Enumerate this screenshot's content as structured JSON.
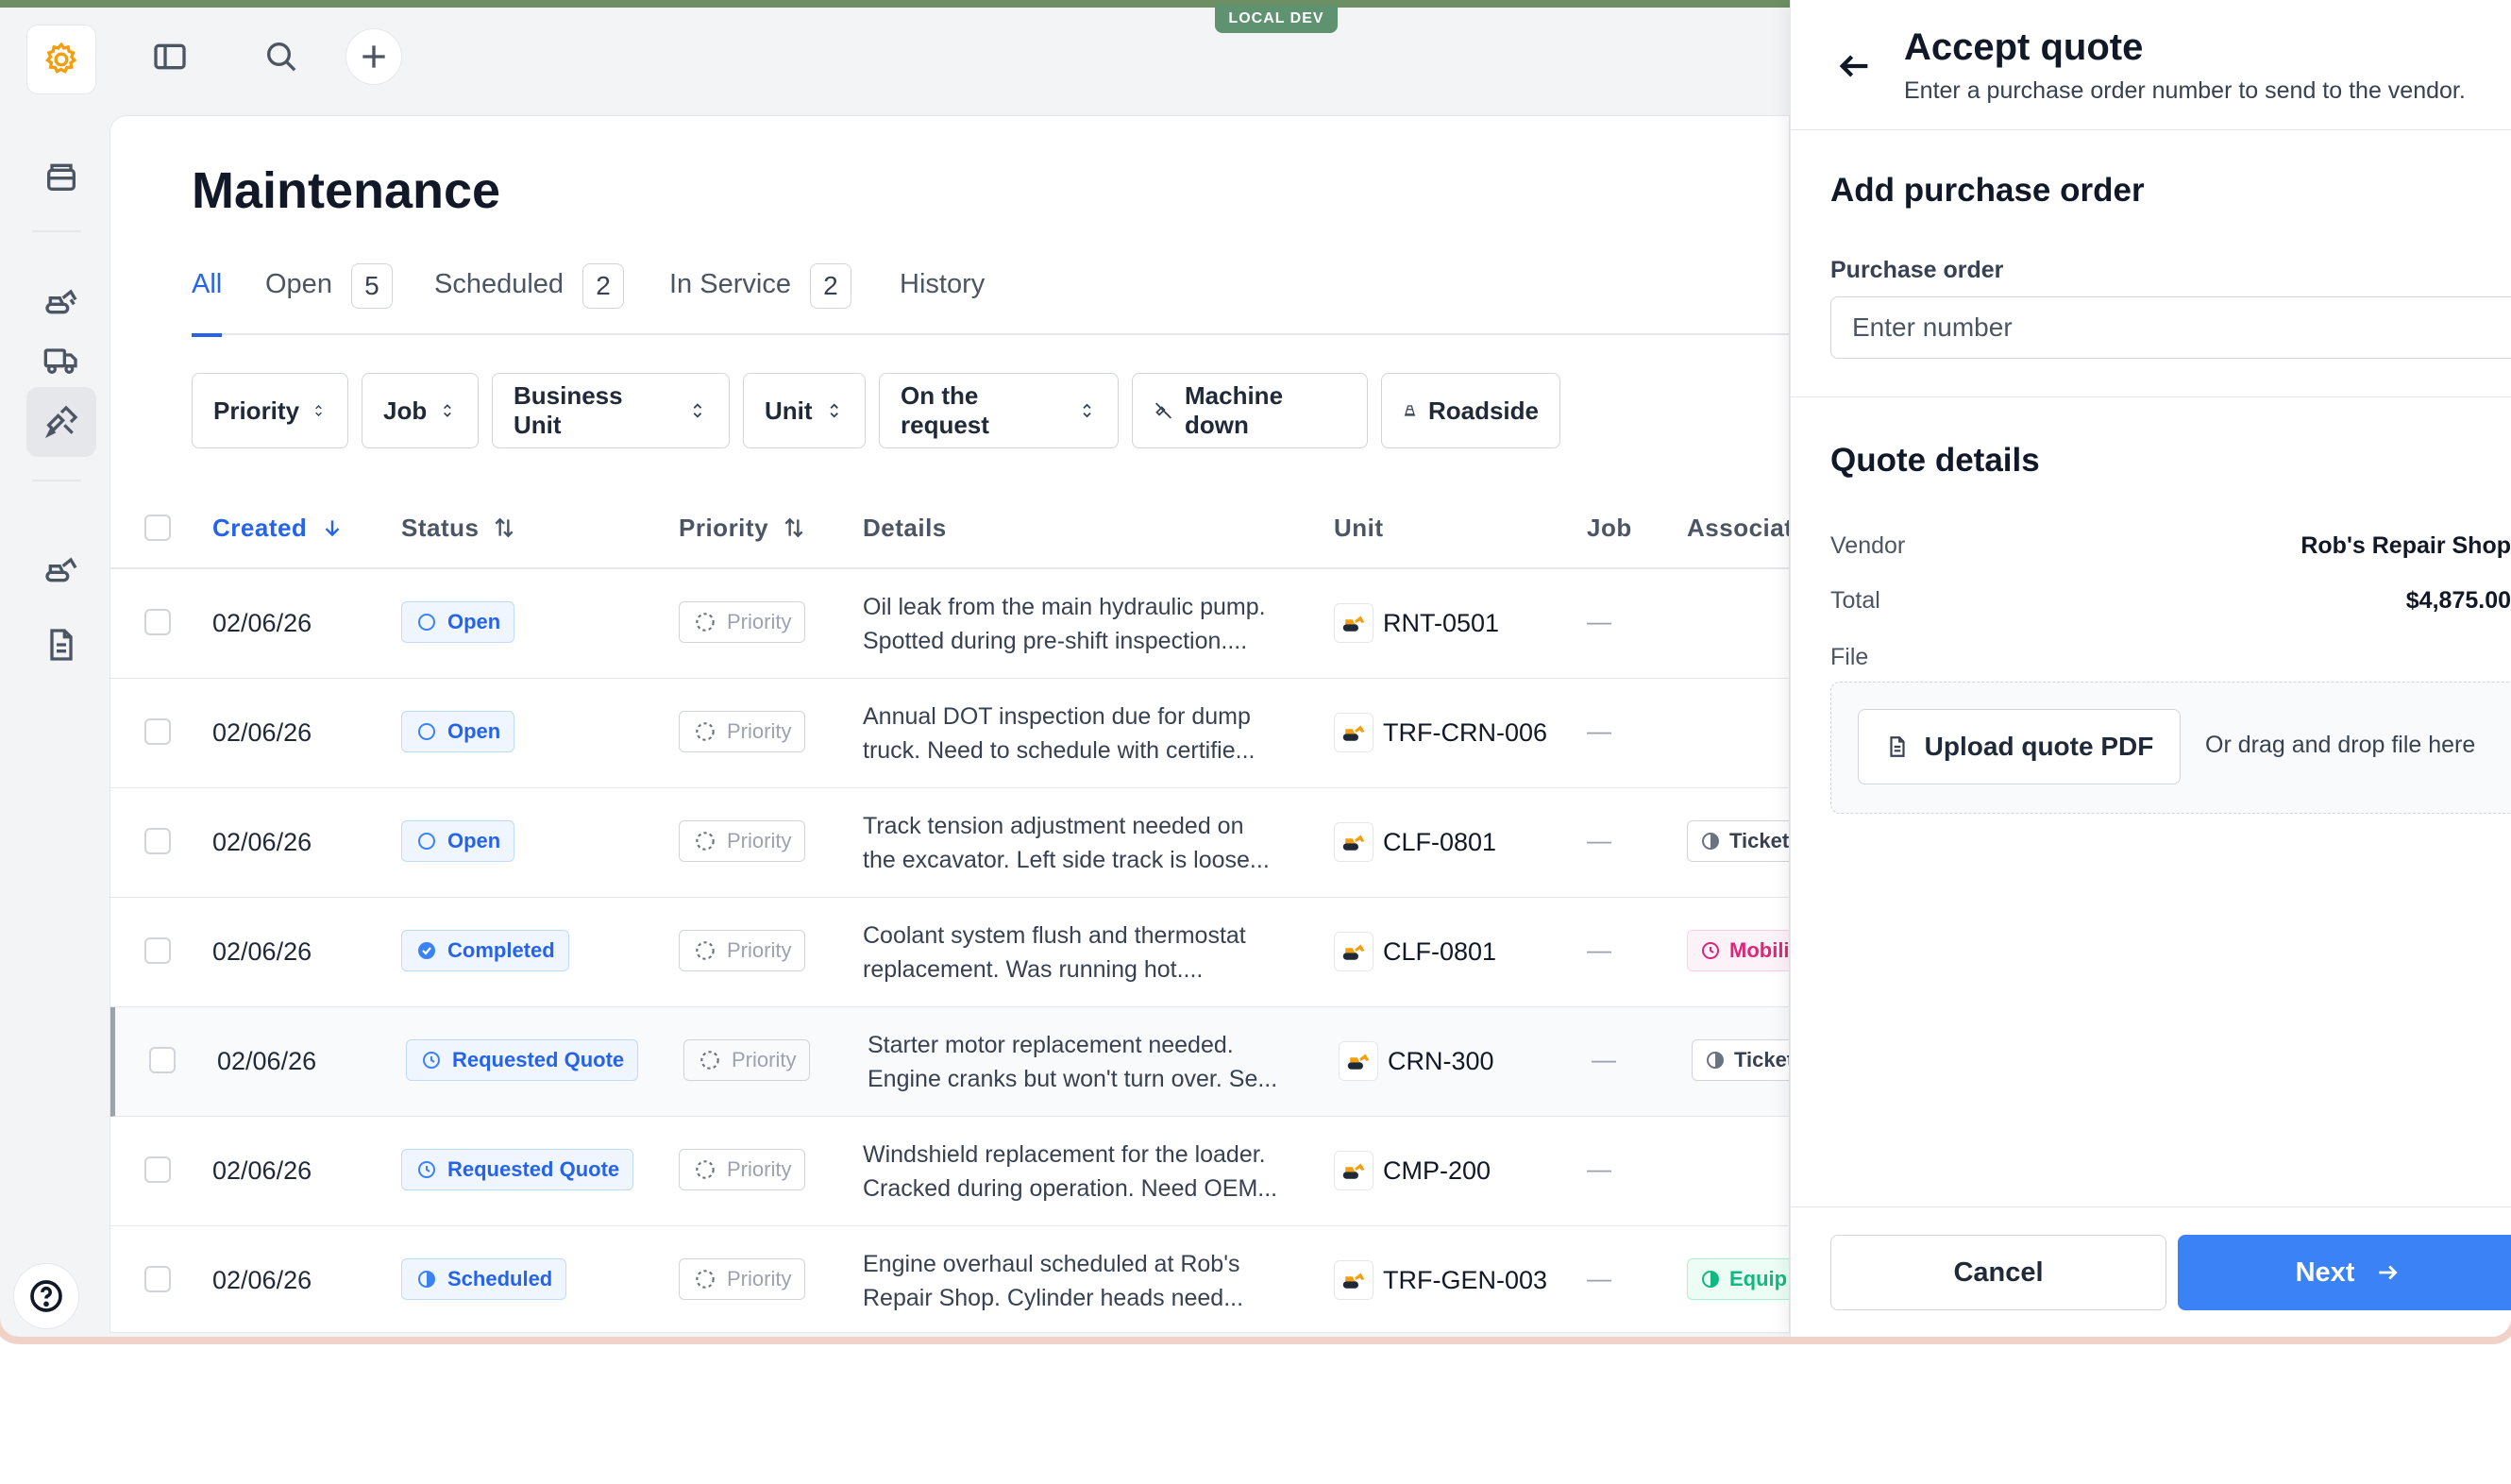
{
  "env_badge": "LOCAL DEV",
  "page": {
    "title": "Maintenance"
  },
  "tabs": [
    {
      "label": "All"
    },
    {
      "label": "Open",
      "count": "5"
    },
    {
      "label": "Scheduled",
      "count": "2"
    },
    {
      "label": "In Service",
      "count": "2"
    },
    {
      "label": "History"
    }
  ],
  "filters": [
    "Priority",
    "Job",
    "Business Unit",
    "Unit",
    "On the request",
    "Machine down",
    "Roadside"
  ],
  "columns": {
    "created": "Created",
    "status": "Status",
    "priority": "Priority",
    "details": "Details",
    "unit": "Unit",
    "job": "Job",
    "associated": "Associat"
  },
  "rows": [
    {
      "date": "02/06/26",
      "status": "Open",
      "priority": "Priority",
      "details1": "Oil leak from the main hydraulic pump.",
      "details2": "Spotted during pre-shift inspection....",
      "unit": "RNT-0501",
      "job": "—",
      "assoc": ""
    },
    {
      "date": "02/06/26",
      "status": "Open",
      "priority": "Priority",
      "details1": "Annual DOT inspection due for dump",
      "details2": "truck. Need to schedule with certifie...",
      "unit": "TRF-CRN-006",
      "job": "—",
      "assoc": ""
    },
    {
      "date": "02/06/26",
      "status": "Open",
      "priority": "Priority",
      "details1": "Track tension adjustment needed on",
      "details2": "the excavator. Left side track is loose...",
      "unit": "CLF-0801",
      "job": "—",
      "assoc": "Ticket"
    },
    {
      "date": "02/06/26",
      "status": "Completed",
      "priority": "Priority",
      "details1": "Coolant system flush and thermostat",
      "details2": "replacement. Was running hot....",
      "unit": "CLF-0801",
      "job": "—",
      "assoc": "Mobili"
    },
    {
      "date": "02/06/26",
      "status": "Requested Quote",
      "priority": "Priority",
      "details1": "Starter motor replacement needed.",
      "details2": "Engine cranks but won't turn over. Se...",
      "unit": "CRN-300",
      "job": "—",
      "assoc": "Ticket"
    },
    {
      "date": "02/06/26",
      "status": "Requested Quote",
      "priority": "Priority",
      "details1": "Windshield replacement for the loader.",
      "details2": "Cracked during operation. Need OEM...",
      "unit": "CMP-200",
      "job": "—",
      "assoc": ""
    },
    {
      "date": "02/06/26",
      "status": "Scheduled",
      "priority": "Priority",
      "details1": "Engine overhaul scheduled at Rob's",
      "details2": "Repair Shop. Cylinder heads need...",
      "unit": "TRF-GEN-003",
      "job": "—",
      "assoc": "Equip"
    }
  ],
  "drawer": {
    "title": "Accept quote",
    "subtitle": "Enter a purchase order number to send to the vendor.",
    "po_section": "Add purchase order",
    "po_label": "Purchase order",
    "po_placeholder": "Enter number",
    "po_value": "",
    "quote_section": "Quote details",
    "vendor_label": "Vendor",
    "vendor_value": "Rob's Repair Shop",
    "total_label": "Total",
    "total_value": "$4,875.00",
    "file_label": "File",
    "upload_label": "Upload quote PDF",
    "drop_text": "Or drag and drop file here",
    "cancel": "Cancel",
    "next": "Next"
  },
  "colors": {
    "accent": "#2563eb",
    "primary_button": "#3b82f6",
    "env_badge": "#5e9270"
  }
}
